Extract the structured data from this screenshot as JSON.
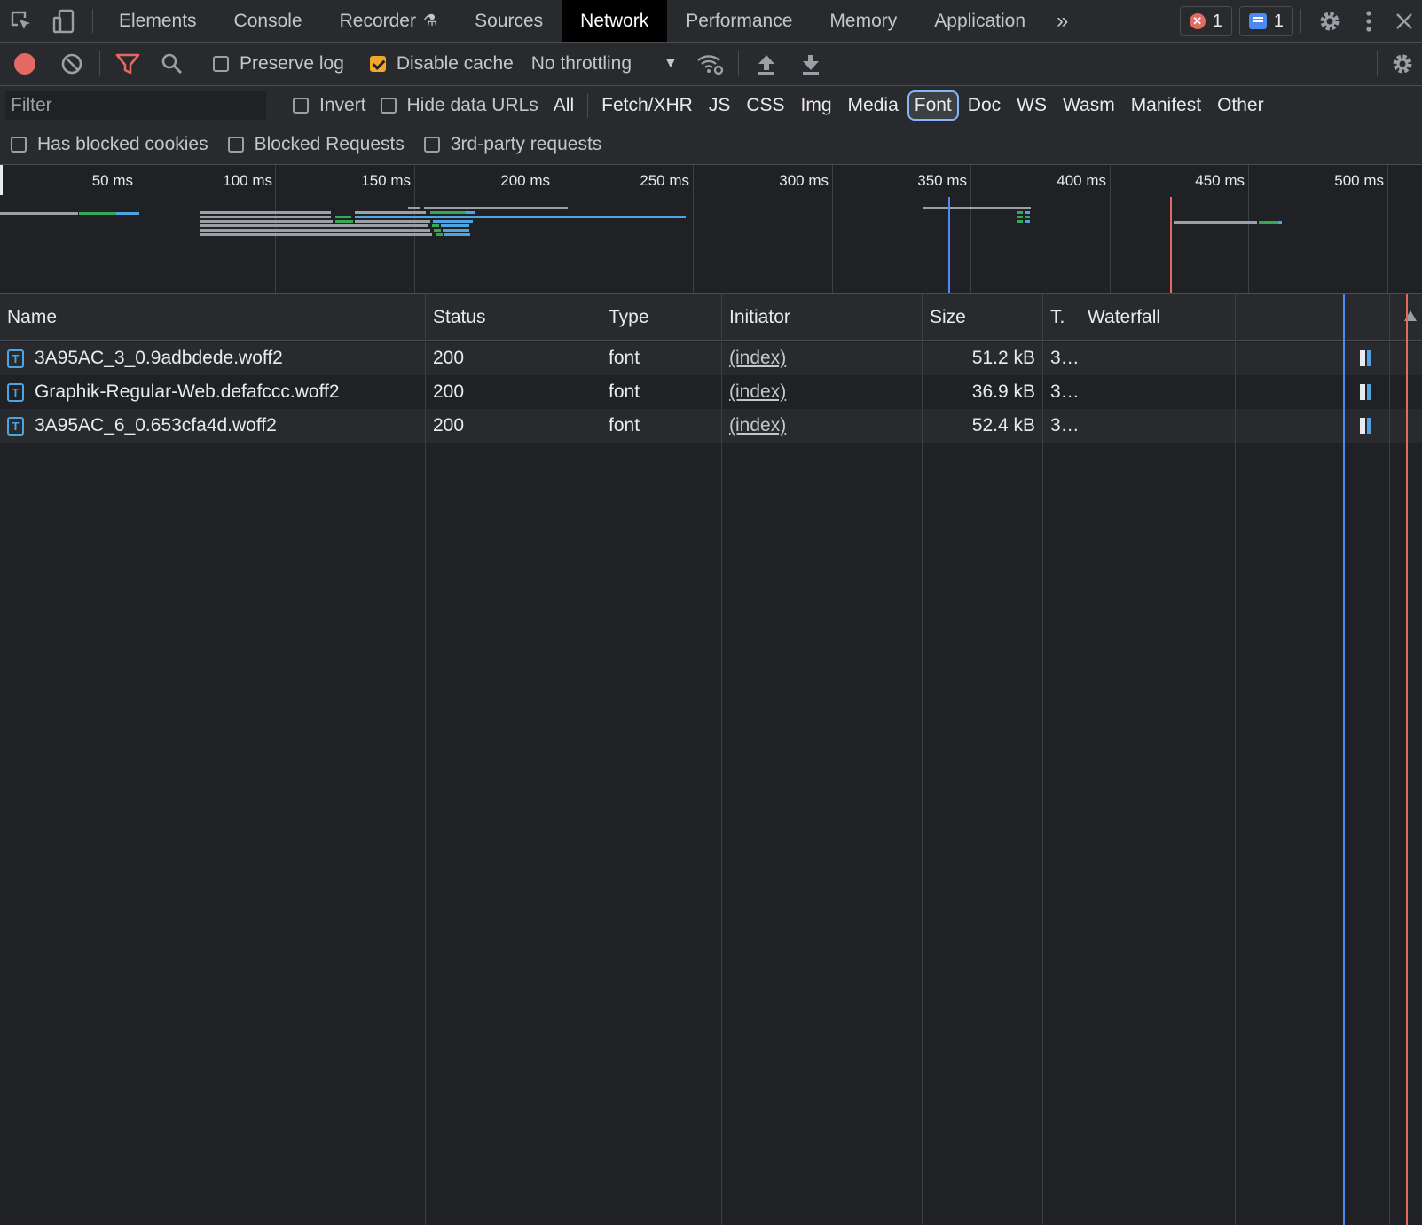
{
  "tabs": [
    {
      "label": "Elements"
    },
    {
      "label": "Console"
    },
    {
      "label": "Recorder"
    },
    {
      "label": "Sources"
    },
    {
      "label": "Network"
    },
    {
      "label": "Performance"
    },
    {
      "label": "Memory"
    },
    {
      "label": "Application"
    }
  ],
  "badges": {
    "errors": "1",
    "messages": "1"
  },
  "toolbar": {
    "preserve_log": "Preserve log",
    "disable_cache": "Disable cache",
    "throttling": "No throttling",
    "preserve_log_checked": false,
    "disable_cache_checked": true
  },
  "filter": {
    "placeholder": "Filter",
    "invert": "Invert",
    "hide_data_urls": "Hide data URLs",
    "types": [
      "All",
      "Fetch/XHR",
      "JS",
      "CSS",
      "Img",
      "Media",
      "Font",
      "Doc",
      "WS",
      "Wasm",
      "Manifest",
      "Other"
    ],
    "active_type": "Font",
    "has_blocked_cookies": "Has blocked cookies",
    "blocked_requests": "Blocked Requests",
    "third_party": "3rd-party requests"
  },
  "overview": {
    "ticks": [
      "50 ms",
      "100 ms",
      "150 ms",
      "200 ms",
      "250 ms",
      "300 ms",
      "350 ms",
      "400 ms",
      "450 ms",
      "500 ms"
    ]
  },
  "table": {
    "headers": {
      "name": "Name",
      "status": "Status",
      "type": "Type",
      "initiator": "Initiator",
      "size": "Size",
      "time": "T.",
      "waterfall": "Waterfall"
    },
    "rows": [
      {
        "name": "3A95AC_3_0.9adbdede.woff2",
        "status": "200",
        "type": "font",
        "initiator": "(index)",
        "size": "51.2 kB",
        "time": "3…"
      },
      {
        "name": "Graphik-Regular-Web.defafccc.woff2",
        "status": "200",
        "type": "font",
        "initiator": "(index)",
        "size": "36.9 kB",
        "time": "3…"
      },
      {
        "name": "3A95AC_6_0.653cfa4d.woff2",
        "status": "200",
        "type": "font",
        "initiator": "(index)",
        "size": "52.4 kB",
        "time": "3…"
      }
    ]
  },
  "colors": {
    "accent": "#8ab4f8",
    "record": "#e46962",
    "checkbox": "#f2a62b",
    "dom_content_loaded": "#4a8af4",
    "load": "#e46962"
  }
}
